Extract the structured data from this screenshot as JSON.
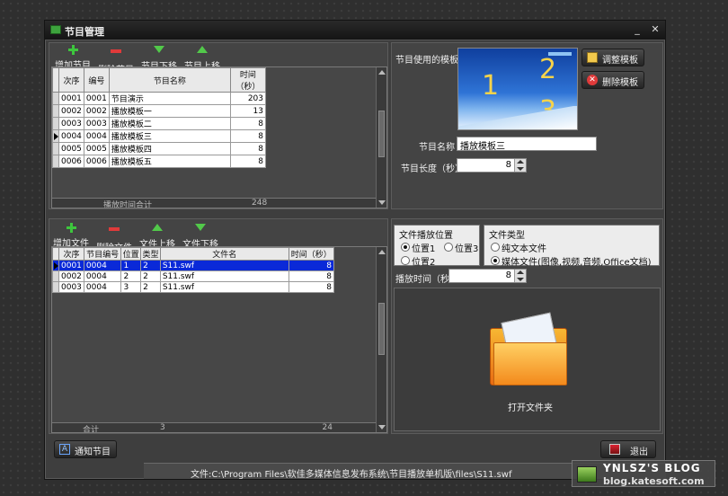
{
  "window": {
    "title": "节目管理"
  },
  "program_toolbar": [
    {
      "label": "增加节目",
      "icon": "plus-icon"
    },
    {
      "label": "删除节目",
      "icon": "minus-icon"
    },
    {
      "label": "节目下移",
      "icon": "arrow-down-icon"
    },
    {
      "label": "节目上移",
      "icon": "arrow-up-icon"
    }
  ],
  "program_table": {
    "columns": [
      "次序",
      "编号",
      "节目名称",
      "时间（秒）"
    ],
    "rows": [
      {
        "order": "0001",
        "id": "0001",
        "name": "节目演示",
        "time": "203",
        "current": false
      },
      {
        "order": "0002",
        "id": "0002",
        "name": "播放模板一",
        "time": "13",
        "current": false
      },
      {
        "order": "0003",
        "id": "0003",
        "name": "播放模板二",
        "time": "8",
        "current": false
      },
      {
        "order": "0004",
        "id": "0004",
        "name": "播放模板三",
        "time": "8",
        "current": true
      },
      {
        "order": "0005",
        "id": "0005",
        "name": "播放模板四",
        "time": "8",
        "current": false
      },
      {
        "order": "0006",
        "id": "0006",
        "name": "播放模板五",
        "time": "8",
        "current": false
      }
    ],
    "footer_label": "播放时间合计",
    "footer_total": "248"
  },
  "template_panel": {
    "template_label": "节目使用的模板",
    "adjust_button": "调整模板",
    "delete_button": "删除模板",
    "thumb_numbers": [
      "1",
      "2",
      "3"
    ],
    "name_label": "节目名称",
    "name_value": "播放模板三",
    "length_label": "节目长度（秒）",
    "length_value": "8"
  },
  "file_toolbar": [
    {
      "label": "增加文件",
      "icon": "plus-icon"
    },
    {
      "label": "删除文件",
      "icon": "minus-icon"
    },
    {
      "label": "文件上移",
      "icon": "arrow-up-icon"
    },
    {
      "label": "文件下移",
      "icon": "arrow-down-icon"
    }
  ],
  "file_table": {
    "columns": [
      "次序",
      "节目编号",
      "位置",
      "类型",
      "文件名",
      "时间（秒）"
    ],
    "rows": [
      {
        "order": "0001",
        "program": "0004",
        "pos": "1",
        "type": "2",
        "file": "S11.swf",
        "time": "8",
        "selected": true
      },
      {
        "order": "0002",
        "program": "0004",
        "pos": "2",
        "type": "2",
        "file": "S11.swf",
        "time": "8",
        "selected": false
      },
      {
        "order": "0003",
        "program": "0004",
        "pos": "3",
        "type": "2",
        "file": "S11.swf",
        "time": "8",
        "selected": false
      }
    ],
    "footer_label": "合计",
    "footer_count": "3",
    "footer_total": "24"
  },
  "file_position": {
    "title": "文件播放位置",
    "options": [
      "位置1",
      "位置3",
      "位置2"
    ]
  },
  "file_type": {
    "title": "文件类型",
    "options": [
      "纯文本文件",
      "媒体文件(图像,视频,音频,Office文档)"
    ]
  },
  "play_time": {
    "label": "播放时间（秒）",
    "value": "8"
  },
  "open_folder": {
    "label": "打开文件夹"
  },
  "notify_button": "通知节目",
  "exit_button": "退出",
  "status_text": "文件:C:\\Program Files\\软佳多媒体信息发布系统\\节目播放单机版\\files\\S11.swf",
  "watermark": {
    "line1": "YNLSZ'S BLOG",
    "line2": "blog.katesoft.com"
  },
  "colors": {
    "selection": "#0a29d8",
    "accent_green": "#52c94a",
    "accent_red": "#e03a3a"
  }
}
